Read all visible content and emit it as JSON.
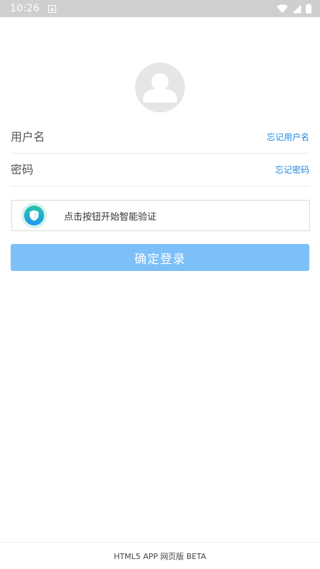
{
  "status_bar": {
    "time": "10:26",
    "icons": [
      "notification-icon",
      "wifi-icon",
      "signal-icon",
      "battery-icon"
    ]
  },
  "avatar": {
    "icon": "user-avatar-icon"
  },
  "username": {
    "placeholder": "用户名",
    "value": "",
    "forgot_label": "忘记用户名"
  },
  "password": {
    "placeholder": "密码",
    "value": "",
    "forgot_label": "忘记密码"
  },
  "captcha": {
    "label": "点击按钮开始智能验证",
    "icon": "shield-icon"
  },
  "login_button": {
    "label": "确定登录"
  },
  "footer": {
    "text": "HTML5 APP 网页版 BETA"
  },
  "colors": {
    "status_bar": "#cfcfcf",
    "link": "#1e88e5",
    "login_button": "#7cbff9",
    "captcha_gradient_top": "#26c6a6",
    "captcha_gradient_bottom": "#2196f3"
  }
}
